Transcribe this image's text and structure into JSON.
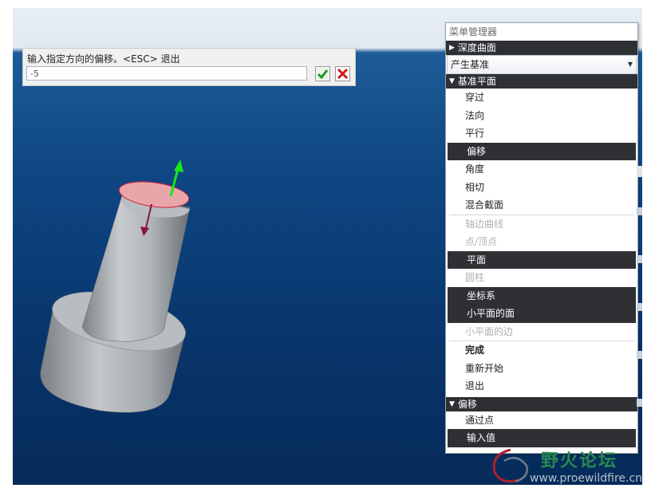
{
  "prompt": {
    "message": "输入指定方向的偏移。<ESC> 退出",
    "value": "-5"
  },
  "menu": {
    "title": "菜单管理器",
    "section_depth": "深度曲面",
    "dropdown_value": "产生基准",
    "section_datum": "基准平面",
    "datum_items": [
      {
        "label": "穿过",
        "state": "normal"
      },
      {
        "label": "法向",
        "state": "normal"
      },
      {
        "label": "平行",
        "state": "normal"
      },
      {
        "label": "偏移",
        "state": "selected"
      },
      {
        "label": "角度",
        "state": "normal"
      },
      {
        "label": "相切",
        "state": "normal"
      },
      {
        "label": "混合截面",
        "state": "normal"
      },
      {
        "label": "轴边曲线",
        "state": "disabled"
      },
      {
        "label": "点/顶点",
        "state": "disabled"
      },
      {
        "label": "平面",
        "state": "selected"
      },
      {
        "label": "圆柱",
        "state": "disabled"
      },
      {
        "label": "坐标系",
        "state": "selected"
      },
      {
        "label": "小平面的面",
        "state": "selected"
      },
      {
        "label": "小平面的边",
        "state": "disabled"
      },
      {
        "label": "完成",
        "state": "bold"
      },
      {
        "label": "重新开始",
        "state": "normal"
      },
      {
        "label": "退出",
        "state": "normal"
      }
    ],
    "section_offset": "偏移",
    "offset_items": [
      {
        "label": "通过点",
        "state": "normal"
      },
      {
        "label": "输入值",
        "state": "selected"
      }
    ]
  },
  "watermark": {
    "name": "野火论坛",
    "url": "www.proewildfire.cn"
  },
  "colors": {
    "menu_selected_bg": "#2e3034",
    "viewport_top": "#1d5c98",
    "viewport_bottom": "#062b5a",
    "arrow_green": "#19e619",
    "arrow_red": "#8a1538",
    "face_highlight": "#e8a6aa"
  },
  "icons": {
    "ok": "green-check-icon",
    "cancel": "red-x-icon"
  }
}
